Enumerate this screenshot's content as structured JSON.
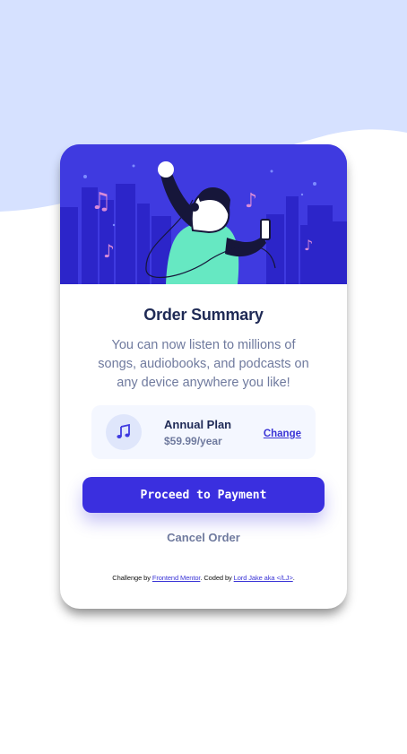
{
  "colors": {
    "page_background": "#ffffff",
    "wave": "#d6e1ff",
    "hero_background": "#3f3ae0",
    "primary": "#3a2fdf",
    "title": "#1f2a55",
    "muted_text": "#6f7a9e",
    "plan_background": "#f4f7ff"
  },
  "card": {
    "hero_image": "illustration-hero",
    "title": "Order Summary",
    "description": "You can now listen to millions of songs, audiobooks, and podcasts on any device anywhere you like!",
    "plan": {
      "icon": "music-icon",
      "name": "Annual Plan",
      "price": "$59.99/year",
      "change_label": "Change"
    },
    "proceed_label": "Proceed to Payment",
    "cancel_label": "Cancel Order"
  },
  "attribution": {
    "prefix": "Challenge by ",
    "challenge_link": "Frontend Mentor",
    "middle": ". Coded by ",
    "author_link": "Lord Jake aka </LJ>",
    "suffix": "."
  }
}
